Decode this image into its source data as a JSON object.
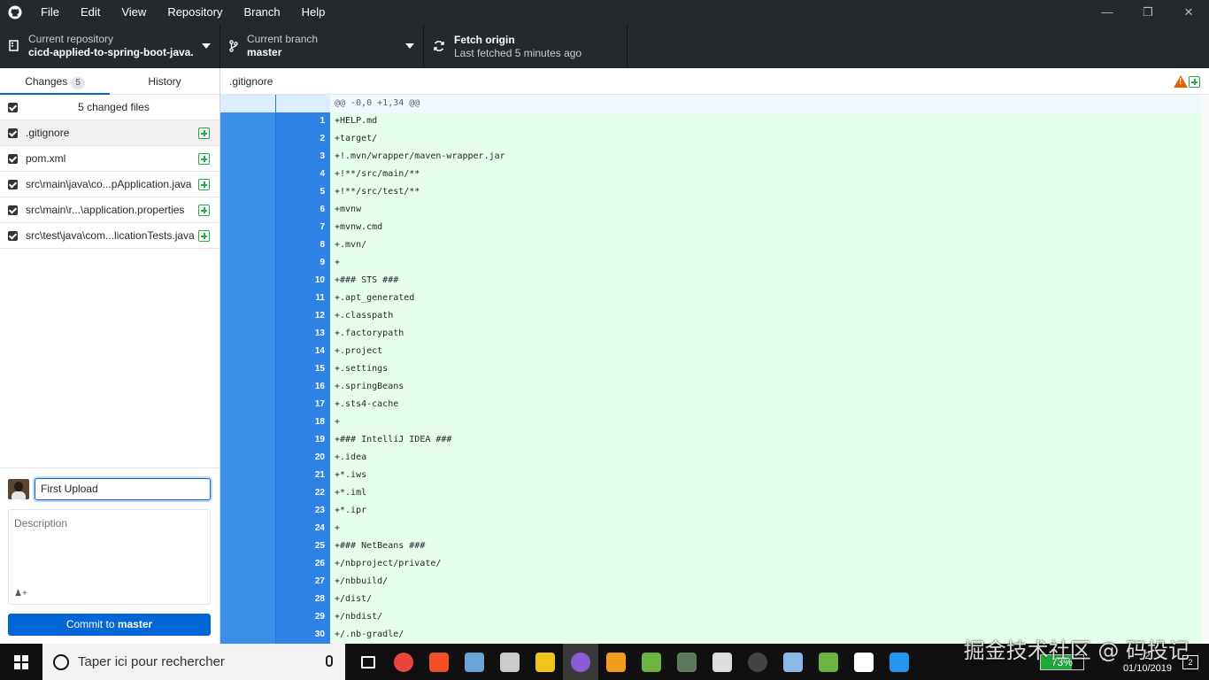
{
  "menu": [
    "File",
    "Edit",
    "View",
    "Repository",
    "Branch",
    "Help"
  ],
  "toolbar": {
    "repo_label": "Current repository",
    "repo_value": "cicd-applied-to-spring-boot-java...",
    "branch_label": "Current branch",
    "branch_value": "master",
    "fetch_label": "Fetch origin",
    "fetch_sub": "Last fetched 5 minutes ago"
  },
  "tabs": {
    "changes": "Changes",
    "changes_count": "5",
    "history": "History"
  },
  "changes_summary": "5 changed files",
  "files": [
    {
      "name": ".gitignore"
    },
    {
      "name": "pom.xml"
    },
    {
      "name": "src\\main\\java\\co...pApplication.java"
    },
    {
      "name": "src\\main\\r...\\application.properties"
    },
    {
      "name": "src\\test\\java\\com...licationTests.java"
    }
  ],
  "commit": {
    "summary_value": "First Upload",
    "description_placeholder": "Description",
    "button_prefix": "Commit to ",
    "button_branch": "master"
  },
  "diff": {
    "file": ".gitignore",
    "hunk": "@@ -0,0 +1,34 @@",
    "lines": [
      {
        "n": "1",
        "t": "+HELP.md"
      },
      {
        "n": "2",
        "t": "+target/"
      },
      {
        "n": "3",
        "t": "+!.mvn/wrapper/maven-wrapper.jar"
      },
      {
        "n": "4",
        "t": "+!**/src/main/**"
      },
      {
        "n": "5",
        "t": "+!**/src/test/**"
      },
      {
        "n": "6",
        "t": "+mvnw"
      },
      {
        "n": "7",
        "t": "+mvnw.cmd"
      },
      {
        "n": "8",
        "t": "+.mvn/"
      },
      {
        "n": "9",
        "t": "+"
      },
      {
        "n": "10",
        "t": "+### STS ###"
      },
      {
        "n": "11",
        "t": "+.apt_generated"
      },
      {
        "n": "12",
        "t": "+.classpath"
      },
      {
        "n": "13",
        "t": "+.factorypath"
      },
      {
        "n": "14",
        "t": "+.project"
      },
      {
        "n": "15",
        "t": "+.settings"
      },
      {
        "n": "16",
        "t": "+.springBeans"
      },
      {
        "n": "17",
        "t": "+.sts4-cache"
      },
      {
        "n": "18",
        "t": "+"
      },
      {
        "n": "19",
        "t": "+### IntelliJ IDEA ###"
      },
      {
        "n": "20",
        "t": "+.idea"
      },
      {
        "n": "21",
        "t": "+*.iws"
      },
      {
        "n": "22",
        "t": "+*.iml"
      },
      {
        "n": "23",
        "t": "+*.ipr"
      },
      {
        "n": "24",
        "t": "+"
      },
      {
        "n": "25",
        "t": "+### NetBeans ###"
      },
      {
        "n": "26",
        "t": "+/nbproject/private/"
      },
      {
        "n": "27",
        "t": "+/nbbuild/"
      },
      {
        "n": "28",
        "t": "+/dist/"
      },
      {
        "n": "29",
        "t": "+/nbdist/"
      },
      {
        "n": "30",
        "t": "+/.nb-gradle/"
      }
    ]
  },
  "taskbar": {
    "search_placeholder": "Taper ici pour rechercher",
    "battery": "73%",
    "battery_level": 0.73,
    "time_partial": "2",
    "date": "01/10/2019",
    "notifications": "2",
    "watermark": "掘金技术社区 @ 码投记",
    "apps": [
      {
        "name": "task-view-icon",
        "color": "#101010"
      },
      {
        "name": "chrome-icon",
        "color": "#e8453c"
      },
      {
        "name": "store-icon",
        "color": "#f25022"
      },
      {
        "name": "app-icon",
        "color": "#6aa3d8"
      },
      {
        "name": "screenshot-icon",
        "color": "#cccccc"
      },
      {
        "name": "explorer-icon",
        "color": "#f0c419"
      },
      {
        "name": "github-desktop-icon",
        "color": "#8a5cd6"
      },
      {
        "name": "sublime-icon",
        "color": "#f29b1c"
      },
      {
        "name": "spring-icon",
        "color": "#6db33f"
      },
      {
        "name": "game-icon",
        "color": "#5a7a5a"
      },
      {
        "name": "inkscape-icon",
        "color": "#dddddd"
      },
      {
        "name": "obs-icon",
        "color": "#444444"
      },
      {
        "name": "paint-icon",
        "color": "#8bbbe8"
      },
      {
        "name": "spring-tool-icon",
        "color": "#6db33f"
      },
      {
        "name": "video-editor-icon",
        "color": "#ffffff"
      },
      {
        "name": "docker-icon",
        "color": "#2496ed"
      }
    ]
  }
}
